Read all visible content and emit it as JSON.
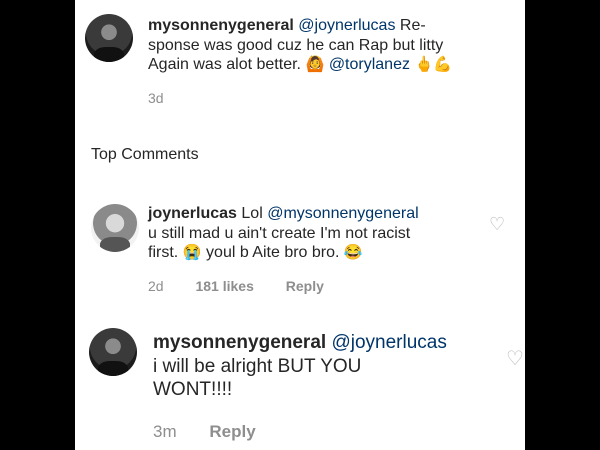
{
  "comments": [
    {
      "username": "mysonnenygeneral",
      "mention": "@joynerlucas",
      "line1_rest": "Re-",
      "line2": "sponse was good cuz he can Rap but litty",
      "line3_pre": "Again was alot better.",
      "line3_emoji1": "🙆",
      "line3_mention": "@torylanez",
      "line3_emoji2": "🖕💪",
      "time": "3d"
    },
    {
      "username": "joynerlucas",
      "line1_pre": "Lol",
      "mention": "@mysonnenygeneral",
      "line2": "u still mad u ain't create I'm not racist",
      "line3_pre": "first.",
      "line3_emoji1": "😭",
      "line3_mid": "youl b Aite bro bro.",
      "line3_emoji2": "😂",
      "time": "2d",
      "likes": "181 likes",
      "reply": "Reply"
    },
    {
      "username": "mysonnenygeneral",
      "mention": "@joynerlucas",
      "line2": "i will be alright BUT YOU",
      "line3": "WONT!!!!",
      "time": "3m",
      "reply": "Reply"
    }
  ],
  "section_title": "Top Comments",
  "icons": {
    "heart": "heart-icon"
  }
}
